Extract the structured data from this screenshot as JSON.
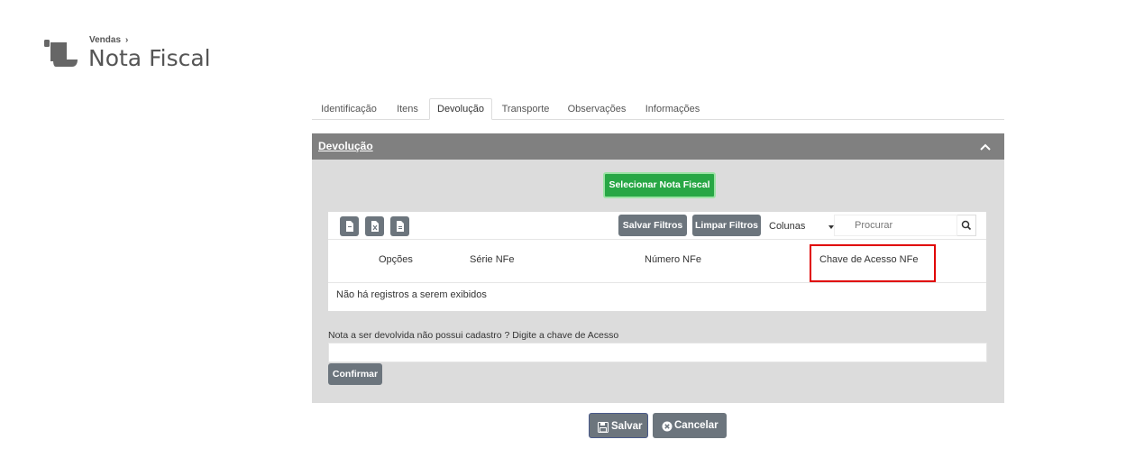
{
  "header": {
    "breadcrumb": "Vendas",
    "breadcrumb_chevron": "›",
    "title": "Nota Fiscal",
    "icon": "scroll-icon"
  },
  "tabs": [
    {
      "label": "Identificação",
      "active": false
    },
    {
      "label": "Itens",
      "active": false
    },
    {
      "label": "Devolução",
      "active": true
    },
    {
      "label": "Transporte",
      "active": false
    },
    {
      "label": "Observações",
      "active": false
    },
    {
      "label": "Informações",
      "active": false
    }
  ],
  "panel": {
    "title": "Devolução",
    "select_button": "Selecionar Nota Fiscal",
    "toolbar": {
      "export_icons": [
        "pdf-export-icon",
        "excel-export-icon",
        "file-export-icon"
      ],
      "save_filters": "Salvar Filtros",
      "clear_filters": "Limpar Filtros",
      "columns": "Colunas",
      "search_placeholder": "Procurar"
    },
    "columns": [
      "Opções",
      "Série NFe",
      "Número NFe",
      "Chave de Acesso NFe"
    ],
    "empty_message": "Não há registros a serem exibidos",
    "note_label": "Nota a ser devolvida não possui cadastro ? Digite a chave de Acesso",
    "note_value": "",
    "confirm": "Confirmar"
  },
  "footer": {
    "save": "Salvar",
    "cancel": "Cancelar"
  },
  "colors": {
    "accent_green": "#28a745",
    "button_gray": "#6c757d",
    "panel_header": "#808080",
    "panel_bg": "#dcdcdc",
    "highlight": "#e00000"
  }
}
